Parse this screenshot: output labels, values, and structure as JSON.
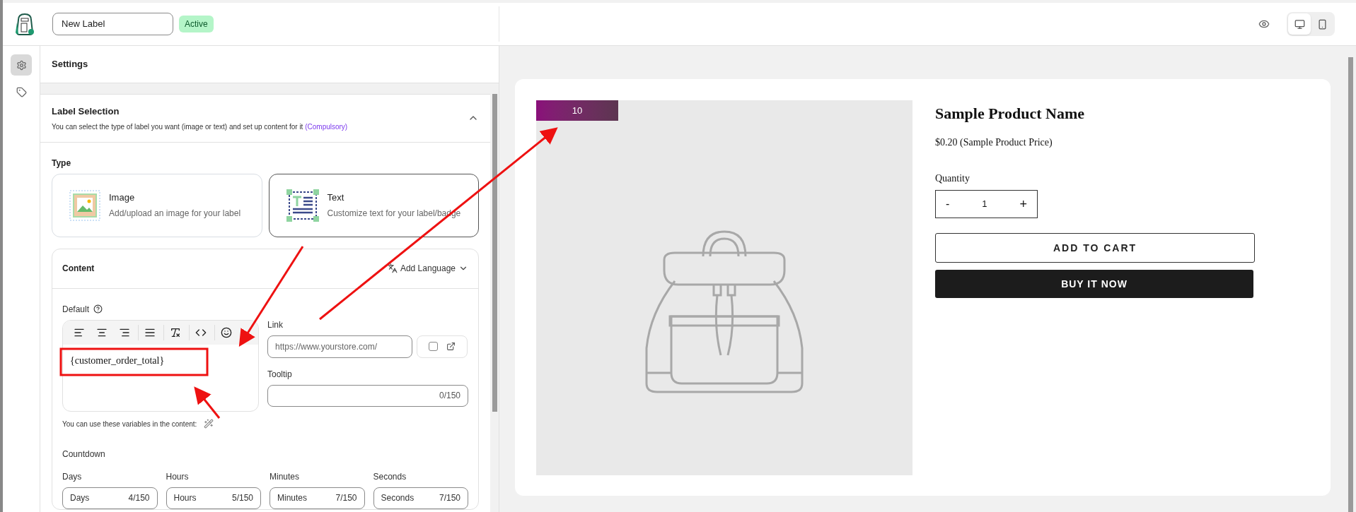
{
  "header": {
    "label_name": "New Label",
    "status": "Active",
    "device_toggle": [
      {
        "kind": "desktop",
        "selected": true
      },
      {
        "kind": "mobile",
        "selected": false
      }
    ]
  },
  "rail": [
    {
      "kind": "settings",
      "selected": true
    },
    {
      "kind": "tag",
      "selected": false
    }
  ],
  "settings": {
    "title": "Settings",
    "label_selection": {
      "title": "Label Selection",
      "description": "You can select the type of label you want (image or text) and set up content for it",
      "note": "(Compulsory)",
      "expanded": true,
      "type_heading": "Type",
      "types": [
        {
          "kind": "image",
          "title": "Image",
          "description": "Add/upload an image for your label",
          "selected": false
        },
        {
          "kind": "text",
          "title": "Text",
          "description": "Customize text for your label/badge",
          "selected": true
        }
      ],
      "content": {
        "title": "Content",
        "add_language": "Add Language",
        "default_label": "Default",
        "editor_text": "{customer_order_total}",
        "variables_hint": "You can use these variables in the content:",
        "link": {
          "label": "Link",
          "placeholder": "https://www.yourstore.com/",
          "new_tab": false
        },
        "tooltip": {
          "label": "Tooltip",
          "counter": "0/150"
        },
        "countdown": {
          "title": "Countdown",
          "fields": [
            {
              "label": "Days",
              "value": "Days",
              "counter": "4/150"
            },
            {
              "label": "Hours",
              "value": "Hours",
              "counter": "5/150"
            },
            {
              "label": "Minutes",
              "value": "Minutes",
              "counter": "7/150"
            },
            {
              "label": "Seconds",
              "value": "Seconds",
              "counter": "7/150"
            }
          ]
        }
      }
    }
  },
  "preview": {
    "badge": "10",
    "product_name": "Sample Product Name",
    "price": "$0.20 (Sample Product Price)",
    "quantity_label": "Quantity",
    "quantity": {
      "minus": "-",
      "value": "1",
      "plus": "+"
    },
    "add_to_cart": "ADD TO CART",
    "buy_now": "BUY IT NOW"
  }
}
